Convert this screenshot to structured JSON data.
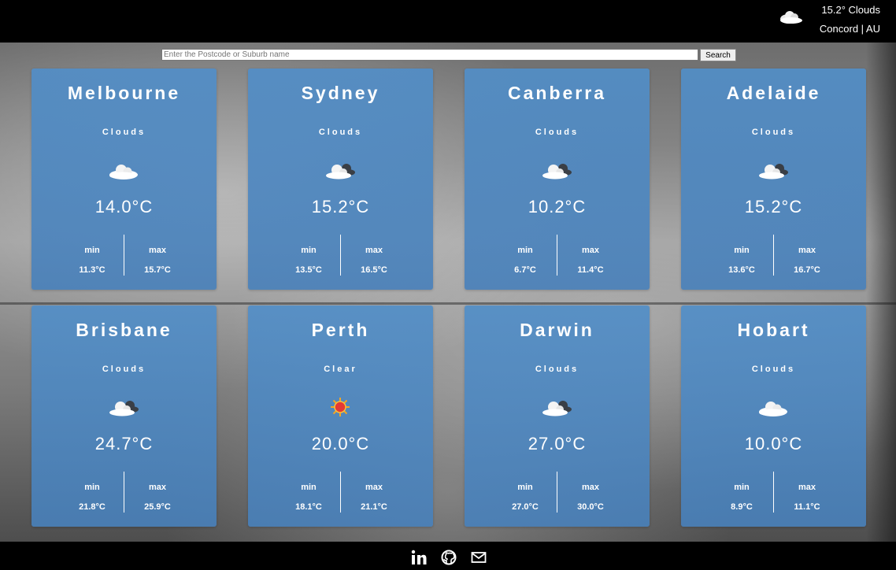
{
  "header": {
    "current_temp_cond": "15.2° Clouds",
    "location": "Concord | AU",
    "icon": "cloud-icon"
  },
  "search": {
    "placeholder": "Enter the Postcode or Suburb name",
    "button_label": "Search"
  },
  "labels": {
    "min": "min",
    "max": "max"
  },
  "cities": [
    {
      "name": "Melbourne",
      "condition": "Clouds",
      "icon": "cloud-icon",
      "temp": "14.0°C",
      "min": "11.3°C",
      "max": "15.7°C"
    },
    {
      "name": "Sydney",
      "condition": "Clouds",
      "icon": "cloud-dark-icon",
      "temp": "15.2°C",
      "min": "13.5°C",
      "max": "16.5°C"
    },
    {
      "name": "Canberra",
      "condition": "Clouds",
      "icon": "cloud-dark-icon",
      "temp": "10.2°C",
      "min": "6.7°C",
      "max": "11.4°C"
    },
    {
      "name": "Adelaide",
      "condition": "Clouds",
      "icon": "cloud-dark-icon",
      "temp": "15.2°C",
      "min": "13.6°C",
      "max": "16.7°C"
    },
    {
      "name": "Brisbane",
      "condition": "Clouds",
      "icon": "cloud-dark-icon",
      "temp": "24.7°C",
      "min": "21.8°C",
      "max": "25.9°C"
    },
    {
      "name": "Perth",
      "condition": "Clear",
      "icon": "sun-icon",
      "temp": "20.0°C",
      "min": "18.1°C",
      "max": "21.1°C"
    },
    {
      "name": "Darwin",
      "condition": "Clouds",
      "icon": "cloud-dark-icon",
      "temp": "27.0°C",
      "min": "27.0°C",
      "max": "30.0°C"
    },
    {
      "name": "Hobart",
      "condition": "Clouds",
      "icon": "cloud-icon",
      "temp": "10.0°C",
      "min": "8.9°C",
      "max": "11.1°C"
    }
  ],
  "footer": {
    "icons": [
      "linkedin-icon",
      "github-icon",
      "mail-icon"
    ]
  }
}
